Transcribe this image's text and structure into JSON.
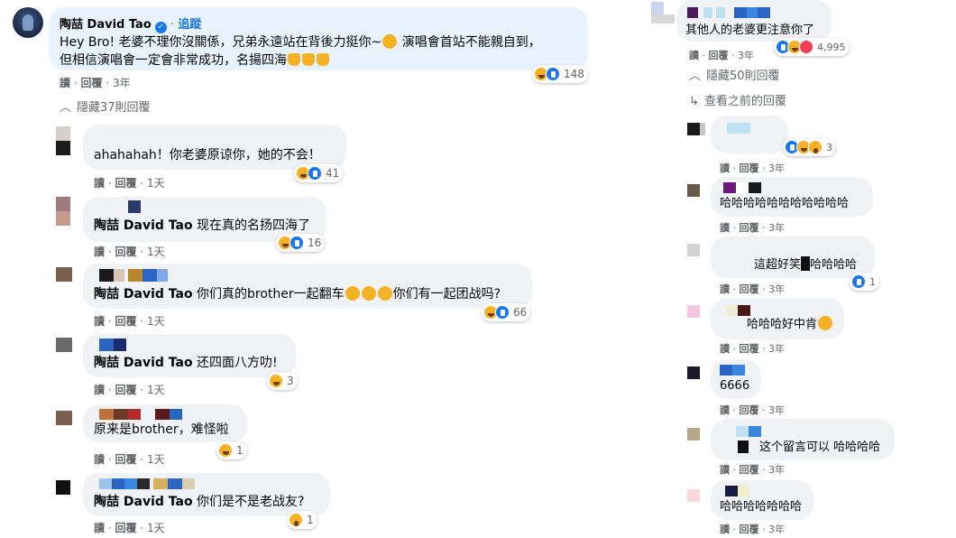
{
  "ui": {
    "read": "讀",
    "reply": "回覆",
    "sep": "·",
    "follow": "追蹤",
    "colors": {
      "link": "#1877f2",
      "bubble": "#f0f2f5",
      "meta": "#65676b"
    }
  },
  "main_comment": {
    "author": "陶喆 David Tao",
    "follow": "追蹤",
    "text_line1": "Hey Bro! 老婆不理你沒關係，兄弟永遠站在背後力挺你~",
    "text_line1b": " 演唱會首站不能親自到，",
    "text_line2": "但相信演唱會一定會非常成功，名揚四海",
    "time": "3年",
    "reaction_count": "148",
    "reactions": [
      "haha-icon",
      "like-icon"
    ]
  },
  "left_toggle": "隱藏37則回覆",
  "left_replies": [
    {
      "text": "ahahahah！你老婆原谅你，她的不会！",
      "time": "1天",
      "count": "41",
      "reactions": [
        "haha-icon",
        "like-icon"
      ]
    },
    {
      "author": "陶喆 David Tao",
      "text": " 现在真的名扬四海了",
      "time": "1天",
      "count": "16",
      "reactions": [
        "haha-icon",
        "like-icon"
      ]
    },
    {
      "author": "陶喆 David Tao",
      "text": " 你们真的brother一起翻车",
      "text_tail": "你们有一起团战吗?",
      "time": "1天",
      "count": "66",
      "reactions": [
        "haha-icon",
        "like-icon"
      ]
    },
    {
      "author": "陶喆 David Tao",
      "text": " 还四面八方叻!",
      "time": "1天",
      "count": "3",
      "reactions": [
        "haha-icon"
      ]
    },
    {
      "text": "原来是brother，难怪啦",
      "time": "1天",
      "count": "1",
      "reactions": [
        "haha-icon"
      ]
    },
    {
      "author": "陶喆 David Tao",
      "text": " 你们是不是老战友?",
      "time": "1天",
      "count": "1",
      "reactions": [
        "wow-icon"
      ]
    }
  ],
  "right_top": {
    "text": "其他人的老婆更注意你了",
    "time": "3年",
    "count": "4,995",
    "reactions": [
      "like-icon",
      "haha-icon",
      "love-icon"
    ]
  },
  "right_toggles": {
    "hide": "隱藏50則回覆",
    "prev": "查看之前的回覆"
  },
  "right_replies": [
    {
      "text": "",
      "time": "3年",
      "count": "3",
      "reactions": [
        "like-icon",
        "haha-icon",
        "wow-icon"
      ]
    },
    {
      "text": "哈哈哈哈哈哈哈哈哈哈哈",
      "time": "3年"
    },
    {
      "text_a": "這超好笑",
      "text_b": "哈哈哈哈",
      "time": "3年",
      "count": "1",
      "reactions": [
        "like-icon"
      ]
    },
    {
      "text": "哈哈哈好中肯",
      "time": "3年"
    },
    {
      "text": "6666",
      "time": "3年"
    },
    {
      "text": "这个留言可以 哈哈哈哈",
      "time": "3年"
    },
    {
      "text": "哈哈哈哈哈哈哈",
      "time": "3年"
    }
  ]
}
